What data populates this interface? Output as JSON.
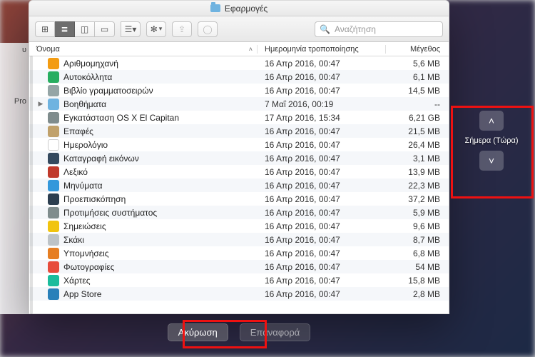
{
  "window": {
    "title": "Εφαρμογές"
  },
  "toolbar": {
    "search_placeholder": "Αναζήτηση",
    "action_glyph": "✻",
    "share_glyph": "⇪",
    "tag_glyph": "◯"
  },
  "columns": {
    "name": "Όνομα",
    "modified": "Ημερομηνία τροποποίησης",
    "size": "Μέγεθος"
  },
  "sidebar_peek": {
    "a": "υ",
    "b": "Pro"
  },
  "buttons": {
    "cancel": "Ακύρωση",
    "restore": "Επαναφορά"
  },
  "time_machine": {
    "up": "˄",
    "down": "˅",
    "label": "Σήμερα (Τώρα)"
  },
  "items": [
    {
      "name": "Αριθμομηχανή",
      "date": "16 Απρ 2016, 00:47",
      "size": "5,6 MB",
      "icon": "ic-calc",
      "expandable": false
    },
    {
      "name": "Αυτοκόλλητα",
      "date": "16 Απρ 2016, 00:47",
      "size": "6,1 MB",
      "icon": "ic-sticker",
      "expandable": false
    },
    {
      "name": "Βιβλίο γραμματοσειρών",
      "date": "16 Απρ 2016, 00:47",
      "size": "14,5 MB",
      "icon": "ic-font",
      "expandable": false
    },
    {
      "name": "Βοηθήματα",
      "date": "7 Μαΐ 2016, 00:19",
      "size": "--",
      "icon": "ic-folder",
      "expandable": true
    },
    {
      "name": "Εγκατάσταση OS X El Capitan",
      "date": "17 Απρ 2016, 15:34",
      "size": "6,21 GB",
      "icon": "ic-install",
      "expandable": false
    },
    {
      "name": "Επαφές",
      "date": "16 Απρ 2016, 00:47",
      "size": "21,5 MB",
      "icon": "ic-contacts",
      "expandable": false
    },
    {
      "name": "Ημερολόγιο",
      "date": "16 Απρ 2016, 00:47",
      "size": "26,4 MB",
      "icon": "ic-cal",
      "expandable": false
    },
    {
      "name": "Καταγραφή εικόνων",
      "date": "16 Απρ 2016, 00:47",
      "size": "3,1 MB",
      "icon": "ic-image",
      "expandable": false
    },
    {
      "name": "Λεξικό",
      "date": "16 Απρ 2016, 00:47",
      "size": "13,9 MB",
      "icon": "ic-dict",
      "expandable": false
    },
    {
      "name": "Μηνύματα",
      "date": "16 Απρ 2016, 00:47",
      "size": "22,3 MB",
      "icon": "ic-msg",
      "expandable": false
    },
    {
      "name": "Προεπισκόπηση",
      "date": "16 Απρ 2016, 00:47",
      "size": "37,2 MB",
      "icon": "ic-preview",
      "expandable": false
    },
    {
      "name": "Προτιμήσεις συστήματος",
      "date": "16 Απρ 2016, 00:47",
      "size": "5,9 MB",
      "icon": "ic-pref",
      "expandable": false
    },
    {
      "name": "Σημειώσεις",
      "date": "16 Απρ 2016, 00:47",
      "size": "9,6 MB",
      "icon": "ic-notes",
      "expandable": false
    },
    {
      "name": "Σκάκι",
      "date": "16 Απρ 2016, 00:47",
      "size": "8,7 MB",
      "icon": "ic-chess",
      "expandable": false
    },
    {
      "name": "Υπομνήσεις",
      "date": "16 Απρ 2016, 00:47",
      "size": "6,8 MB",
      "icon": "ic-rem",
      "expandable": false
    },
    {
      "name": "Φωτογραφίες",
      "date": "16 Απρ 2016, 00:47",
      "size": "54 MB",
      "icon": "ic-photos",
      "expandable": false
    },
    {
      "name": "Χάρτες",
      "date": "16 Απρ 2016, 00:47",
      "size": "15,8 MB",
      "icon": "ic-maps",
      "expandable": false
    },
    {
      "name": "App Store",
      "date": "16 Απρ 2016, 00:47",
      "size": "2,8 MB",
      "icon": "ic-appstore",
      "expandable": false
    }
  ]
}
